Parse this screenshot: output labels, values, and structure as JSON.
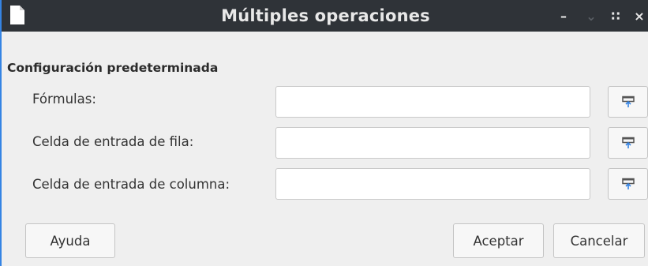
{
  "window": {
    "title": "Múltiples operaciones",
    "controls": {
      "minimize": "–",
      "restore": "⌄",
      "maximize": "∷",
      "close": "×"
    }
  },
  "section": {
    "label": "Configuración predeterminada"
  },
  "rows": [
    {
      "label": "Fórmulas:",
      "value": ""
    },
    {
      "label": "Celda de entrada de fila:",
      "value": ""
    },
    {
      "label": "Celda de entrada de columna:",
      "value": ""
    }
  ],
  "buttons": {
    "help": "Ayuda",
    "ok": "Aceptar",
    "cancel": "Cancelar"
  },
  "colors": {
    "titlebar": "#2f3338",
    "accent_border": "#3584e4",
    "shrink_icon_arrow": "#3584e4"
  },
  "icons": {
    "app": "document-icon",
    "shrink": "shrink-selection-icon"
  }
}
